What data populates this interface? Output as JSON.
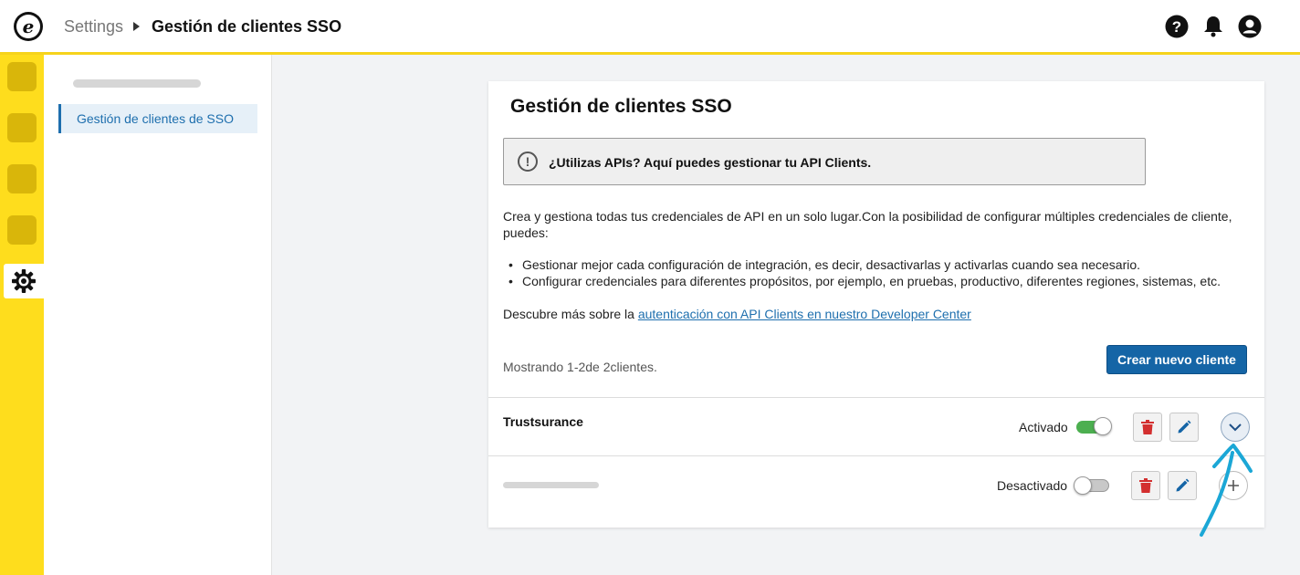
{
  "header": {
    "logo_letter": "e",
    "breadcrumb_root": "Settings",
    "breadcrumb_current": "Gestión de clientes SSO",
    "icons": [
      "help-icon",
      "bell-icon",
      "user-icon"
    ]
  },
  "rail": {
    "icons": [
      "app-tile-icon",
      "app-tile-icon",
      "app-tile-icon",
      "app-tile-icon",
      "gear-icon"
    ]
  },
  "subnav": {
    "active_item": "Gestión de clientes de SSO"
  },
  "main": {
    "title": "Gestión de clientes SSO",
    "notice": "¿Utilizas APIs? Aquí puedes gestionar tu API Clients.",
    "intro": "Crea y gestiona todas tus credenciales de API en un solo lugar.Con la posibilidad de configurar múltiples credenciales de cliente, puedes:",
    "bullets": [
      "Gestionar mejor cada configuración de integración, es decir, desactivarlas y activarlas cuando sea necesario.",
      "Configurar credenciales para diferentes propósitos, por ejemplo, en pruebas, productivo, diferentes regiones, sistemas, etc."
    ],
    "learn_more_prefix": "Descubre más sobre la ",
    "learn_more_link": "autenticación con API Clients en nuestro Developer Center",
    "count_text": "Mostrando 1-2de 2clientes.",
    "create_button": "Crear nuevo cliente",
    "clients": [
      {
        "name": "Trustsurance",
        "status": "Activado",
        "enabled": true,
        "expand_icon": "chevron-down-icon"
      },
      {
        "name": "",
        "status": "Desactivado",
        "enabled": false,
        "expand_icon": "plus-icon"
      }
    ]
  },
  "colors": {
    "accent_yellow": "#fedd1d",
    "primary_blue": "#1565a6",
    "delete_red": "#d32f2f",
    "toggle_green": "#4caf50",
    "annotation_arrow": "#1ba7d6"
  }
}
